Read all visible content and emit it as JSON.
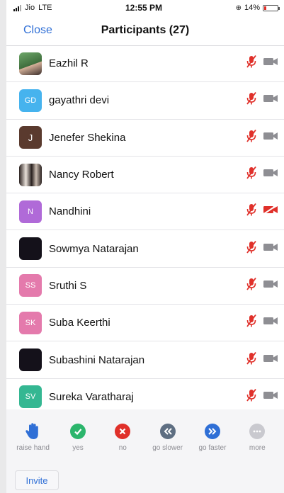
{
  "status_bar": {
    "carrier": "Jio",
    "network": "LTE",
    "time": "12:55 PM",
    "battery_percent": "14%"
  },
  "header": {
    "close_label": "Close",
    "title": "Participants (27)"
  },
  "participants": [
    {
      "name": "Eazhil R",
      "avatar_text": "",
      "avatar_style": "photo1",
      "video_off": false
    },
    {
      "name": "gayathri devi",
      "avatar_text": "GD",
      "avatar_style": "blue",
      "video_off": false
    },
    {
      "name": "Jenefer Shekina",
      "avatar_text": "J",
      "avatar_style": "brown",
      "video_off": false
    },
    {
      "name": "Nancy Robert",
      "avatar_text": "",
      "avatar_style": "photo2",
      "video_off": false
    },
    {
      "name": "Nandhini",
      "avatar_text": "N",
      "avatar_style": "purple",
      "video_off": true
    },
    {
      "name": "Sowmya Natarajan",
      "avatar_text": "",
      "avatar_style": "dark",
      "video_off": false
    },
    {
      "name": "Sruthi S",
      "avatar_text": "SS",
      "avatar_style": "pink",
      "video_off": false
    },
    {
      "name": "Suba Keerthi",
      "avatar_text": "SK",
      "avatar_style": "pink",
      "video_off": false
    },
    {
      "name": "Subashini Natarajan",
      "avatar_text": "",
      "avatar_style": "dark",
      "video_off": false
    },
    {
      "name": "Sureka Varatharaj",
      "avatar_text": "SV",
      "avatar_style": "green",
      "video_off": false
    }
  ],
  "reactions": [
    {
      "label": "raise hand",
      "icon": "raise-hand-icon"
    },
    {
      "label": "yes",
      "icon": "check-icon"
    },
    {
      "label": "no",
      "icon": "x-icon"
    },
    {
      "label": "go slower",
      "icon": "rewind-icon"
    },
    {
      "label": "go faster",
      "icon": "fast-forward-icon"
    },
    {
      "label": "more",
      "icon": "more-icon"
    }
  ],
  "footer": {
    "invite_label": "Invite"
  },
  "colors": {
    "accent": "#2f6fd6",
    "muted_red": "#e0302a",
    "video_gray": "#8e8e93"
  }
}
